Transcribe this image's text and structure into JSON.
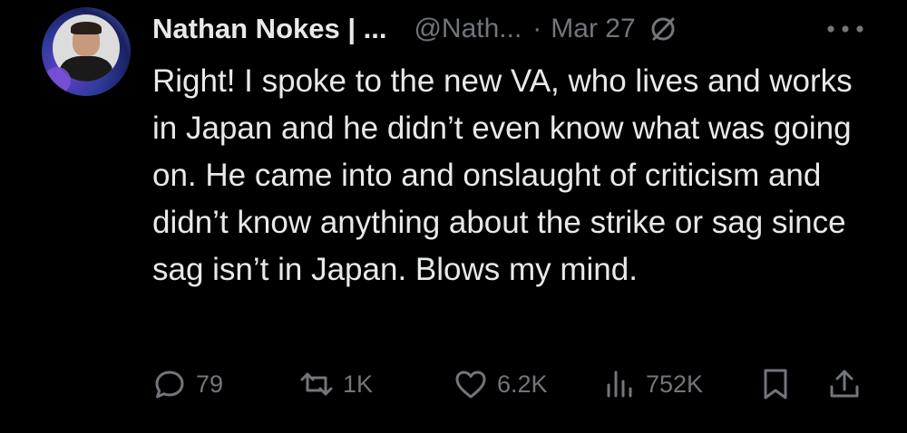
{
  "tweet": {
    "author_name": "Nathan Nokes | ...",
    "handle": "@Nath...",
    "separator": "·",
    "date": "Mar 27",
    "text": "Right! I spoke to the new VA, who lives and works in Japan and he didn’t even know what was going on. He came into and onslaught of criticism and didn’t know anything about the strike or sag since sag isn’t in Japan. Blows my mind."
  },
  "icons": {
    "badge": "grok-slash-circle-icon",
    "more": "more-horizontal-icon",
    "reply": "speech-bubble-icon",
    "retweet": "retweet-arrows-icon",
    "like": "heart-icon",
    "views": "bar-chart-icon",
    "bookmark": "bookmark-icon",
    "share": "share-upload-icon"
  },
  "actions": {
    "replies": "79",
    "retweets": "1K",
    "likes": "6.2K",
    "views": "752K"
  },
  "colors": {
    "background": "#000000",
    "primary_text": "#e7e9ea",
    "secondary_text": "#71767b"
  }
}
